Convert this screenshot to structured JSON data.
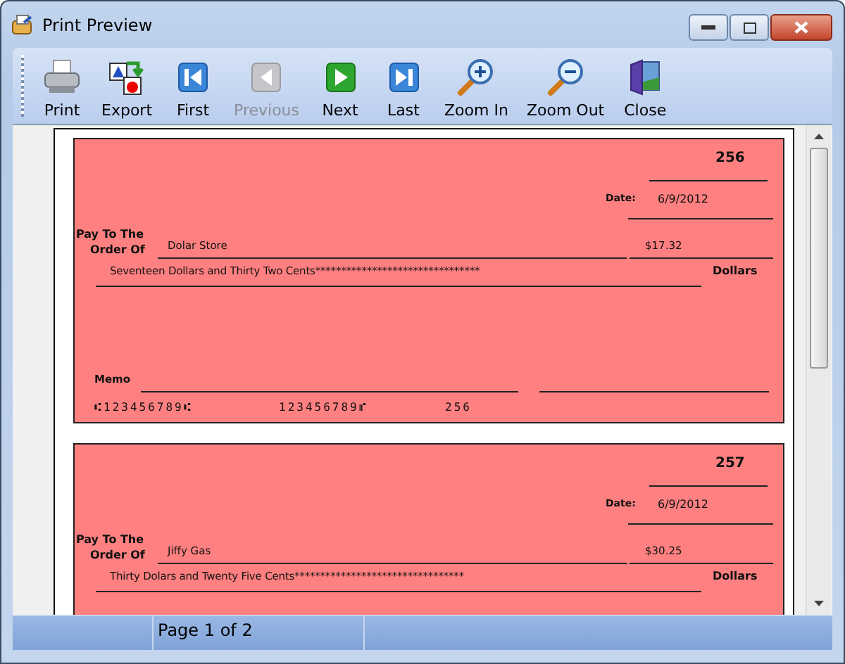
{
  "window": {
    "title": "Print Preview"
  },
  "toolbar": [
    {
      "kind": "print",
      "label": "Print",
      "disabled": false
    },
    {
      "kind": "export",
      "label": "Export",
      "disabled": false
    },
    {
      "kind": "first",
      "label": "First",
      "disabled": false
    },
    {
      "kind": "previous",
      "label": "Previous",
      "disabled": true
    },
    {
      "kind": "next",
      "label": "Next",
      "disabled": false
    },
    {
      "kind": "last",
      "label": "Last",
      "disabled": false
    },
    {
      "kind": "zoom-in",
      "label": "Zoom In",
      "disabled": false
    },
    {
      "kind": "zoom-out",
      "label": "Zoom Out",
      "disabled": false
    },
    {
      "kind": "close",
      "label": "Close",
      "disabled": false
    }
  ],
  "checks": [
    {
      "number": "256",
      "date_label": "Date:",
      "date": "6/9/2012",
      "pay_label": "Pay To The",
      "order_label": "Order Of",
      "payee": "Dolar Store",
      "amount": "$17.32",
      "amount_words": "Seventeen Dollars and Thirty Two Cents********************************",
      "dollars_label": "Dollars",
      "memo_label": "Memo",
      "micr": [
        "⑆123456789⑆",
        "123456789⑈",
        "256"
      ]
    },
    {
      "number": "257",
      "date_label": "Date:",
      "date": "6/9/2012",
      "pay_label": "Pay To The",
      "order_label": "Order Of",
      "payee": "Jiffy Gas",
      "amount": "$30.25",
      "amount_words": "Thirty Dolars and Twenty Five Cents*********************************",
      "dollars_label": "Dollars"
    }
  ],
  "status_bar": {
    "page": "Page 1 of 2"
  }
}
